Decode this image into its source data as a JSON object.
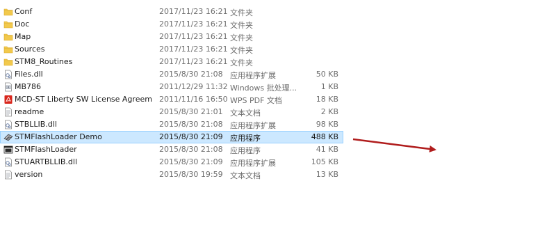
{
  "files": [
    {
      "name": "Conf",
      "date": "2017/11/23 16:21",
      "type": "文件夹",
      "size": "",
      "icon": "folder-icon"
    },
    {
      "name": "Doc",
      "date": "2017/11/23 16:21",
      "type": "文件夹",
      "size": "",
      "icon": "folder-icon"
    },
    {
      "name": "Map",
      "date": "2017/11/23 16:21",
      "type": "文件夹",
      "size": "",
      "icon": "folder-icon"
    },
    {
      "name": "Sources",
      "date": "2017/11/23 16:21",
      "type": "文件夹",
      "size": "",
      "icon": "folder-icon"
    },
    {
      "name": "STM8_Routines",
      "date": "2017/11/23 16:21",
      "type": "文件夹",
      "size": "",
      "icon": "folder-icon"
    },
    {
      "name": "Files.dll",
      "date": "2015/8/30 21:08",
      "type": "应用程序扩展",
      "size": "50 KB",
      "icon": "dll-icon"
    },
    {
      "name": "MB786",
      "date": "2011/12/29 11:32",
      "type": "Windows 批处理...",
      "size": "1 KB",
      "icon": "batch-file-icon"
    },
    {
      "name": "MCD-ST Liberty SW License Agreeme...",
      "date": "2011/11/16 16:50",
      "type": "WPS PDF 文档",
      "size": "18 KB",
      "icon": "pdf-icon"
    },
    {
      "name": "readme",
      "date": "2015/8/30 21:01",
      "type": "文本文档",
      "size": "2 KB",
      "icon": "text-file-icon"
    },
    {
      "name": "STBLLIB.dll",
      "date": "2015/8/30 21:08",
      "type": "应用程序扩展",
      "size": "98 KB",
      "icon": "dll-icon"
    },
    {
      "name": "STMFlashLoader Demo",
      "date": "2015/8/30 21:09",
      "type": "应用程序",
      "size": "488 KB",
      "icon": "flashloader-app-icon",
      "selected": true
    },
    {
      "name": "STMFlashLoader",
      "date": "2015/8/30 21:08",
      "type": "应用程序",
      "size": "41 KB",
      "icon": "console-app-icon"
    },
    {
      "name": "STUARTBLLIB.dll",
      "date": "2015/8/30 21:09",
      "type": "应用程序扩展",
      "size": "105 KB",
      "icon": "dll-icon"
    },
    {
      "name": "version",
      "date": "2015/8/30 19:59",
      "type": "文本文档",
      "size": "13 KB",
      "icon": "text-file-icon"
    }
  ],
  "colors": {
    "selection_bg": "#cce8ff",
    "selection_border": "#99d1ff",
    "folder": "#f2c94c",
    "annotation_arrow": "#b01c1c"
  }
}
